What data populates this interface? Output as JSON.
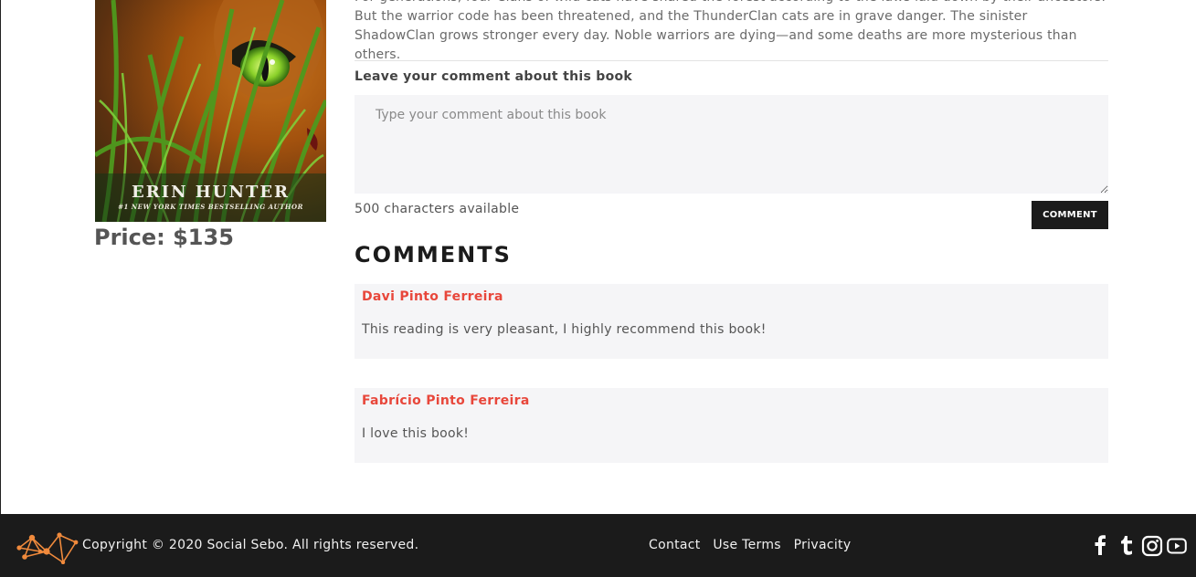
{
  "book": {
    "cover_author": "ERIN HUNTER",
    "cover_tagline": "#1 NEW YORK TIMES BESTSELLING AUTHOR",
    "price": "Price: $135"
  },
  "description": {
    "text": "For generations, four Clans of wild cats have shared the forest according to the laws laid down by their ancestors. But the warrior code has been threatened, and the ThunderClan cats are in grave danger. The sinister ShadowClan grows stronger every day. Noble warriors are dying—and some deaths are more mysterious than others."
  },
  "comment_form": {
    "label": "Leave your comment about this book",
    "placeholder": "Type your comment about this book",
    "value": "",
    "chars_available": "500 characters available",
    "button_label": "COMMENT"
  },
  "comments": {
    "heading": "COMMENTS",
    "items": [
      {
        "author": "Davi Pinto Ferreira",
        "text": "This reading is very pleasant, I highly recommend this book!"
      },
      {
        "author": "Fabrício Pinto Ferreira",
        "text": "I love this book!"
      }
    ]
  },
  "footer": {
    "copyright": "Copyright © 2020 Social Sebo. All rights reserved.",
    "links": [
      "Contact",
      "Use Terms",
      "Privacity"
    ],
    "social_icons": [
      "facebook-icon",
      "tumblr-icon",
      "instagram-icon",
      "youtube-icon"
    ],
    "logo_color": "#f08a3c"
  },
  "colors": {
    "accent": "#e8473b",
    "dark": "#1b1b1b",
    "panel": "#f5f5f7"
  }
}
